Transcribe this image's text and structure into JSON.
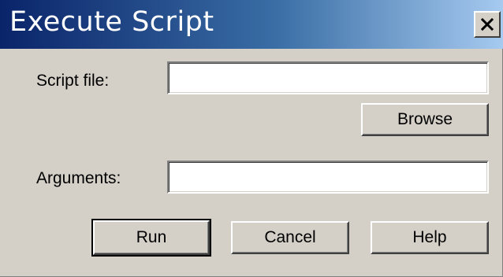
{
  "window": {
    "title": "Execute Script",
    "close_icon": "close-icon"
  },
  "form": {
    "script_file_label": "Script file:",
    "script_file_value": "",
    "browse_label": "Browse",
    "arguments_label": "Arguments:",
    "arguments_value": ""
  },
  "buttons": {
    "run_label": "Run",
    "cancel_label": "Cancel",
    "help_label": "Help"
  },
  "colors": {
    "titlebar_start": "#0a246a",
    "titlebar_end": "#a6caf0",
    "dialog_bg": "#d4d0c8"
  }
}
